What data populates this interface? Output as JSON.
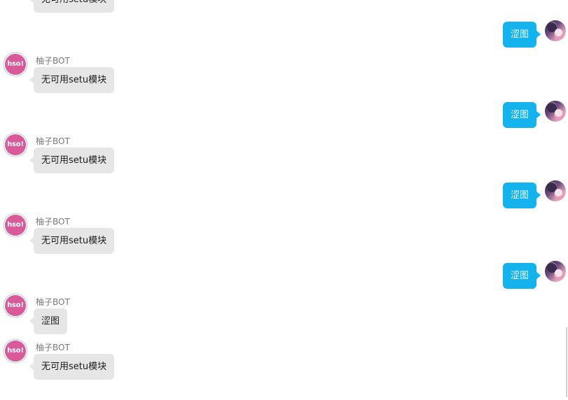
{
  "bot": {
    "name": "柚子BOT",
    "avatar_text": "hso!",
    "avatar_color": "#d85a9a",
    "bubble_color": "#e6e6e6"
  },
  "user": {
    "bubble_color": "#15b3ee"
  },
  "messages": [
    {
      "from": "bot",
      "text": "无可用setu模块",
      "show_name": false
    },
    {
      "from": "user",
      "text": "涩图"
    },
    {
      "from": "bot",
      "text": "无可用setu模块",
      "show_name": true
    },
    {
      "from": "user",
      "text": "涩图"
    },
    {
      "from": "bot",
      "text": "无可用setu模块",
      "show_name": true
    },
    {
      "from": "user",
      "text": "涩图"
    },
    {
      "from": "bot",
      "text": "无可用setu模块",
      "show_name": true
    },
    {
      "from": "user",
      "text": "涩图"
    },
    {
      "from": "bot",
      "text": "涩图",
      "show_name": true
    },
    {
      "from": "bot",
      "text": "无可用setu模块",
      "show_name": true
    }
  ]
}
